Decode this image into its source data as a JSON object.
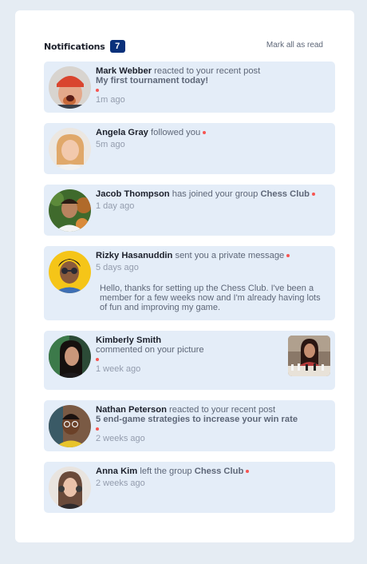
{
  "header": {
    "title": "Notifications",
    "count": "7",
    "mark_all": "Mark all as read"
  },
  "notifications": [
    {
      "name": "Mark Webber",
      "action": "reacted to your recent post",
      "post": "My first tournament today!",
      "time": "1m ago",
      "unread": true,
      "avatar": "avatar-mark-webber"
    },
    {
      "name": "Angela Gray",
      "action": "followed you",
      "time": "5m ago",
      "unread": true,
      "avatar": "avatar-angela-gray"
    },
    {
      "name": "Jacob Thompson",
      "action": "has joined your group",
      "target": "Chess Club",
      "time": "1 day ago",
      "unread": true,
      "avatar": "avatar-jacob-thompson"
    },
    {
      "name": "Rizky Hasanuddin",
      "action": "sent you a private message",
      "time": "5 days ago",
      "unread": true,
      "message": "Hello, thanks for setting up the Chess Club. I've been a member for a few weeks now and I'm already having lots of fun and improving my game.",
      "avatar": "avatar-rizky-hasanuddin"
    },
    {
      "name": "Kimberly Smith",
      "action": "commented on your picture",
      "time": "1 week ago",
      "unread": true,
      "avatar": "avatar-kimberly-smith",
      "picture": "chess-picture"
    },
    {
      "name": "Nathan Peterson",
      "action": "reacted to your recent post",
      "post": "5 end-game strategies to increase your win rate",
      "time": "2 weeks ago",
      "unread": true,
      "avatar": "avatar-nathan-peterson"
    },
    {
      "name": "Anna Kim",
      "action": "left the group",
      "target": "Chess Club",
      "time": "2 weeks ago",
      "unread": true,
      "avatar": "avatar-anna-kim"
    }
  ],
  "colors": {
    "page_bg": "#e5ecf3",
    "card_bg": "#ffffff",
    "unread_bg": "#e4edf8",
    "badge_bg": "#0a317b",
    "dot": "#f65552",
    "name": "#1c202b",
    "text": "#5e6778",
    "time": "#939cad"
  }
}
